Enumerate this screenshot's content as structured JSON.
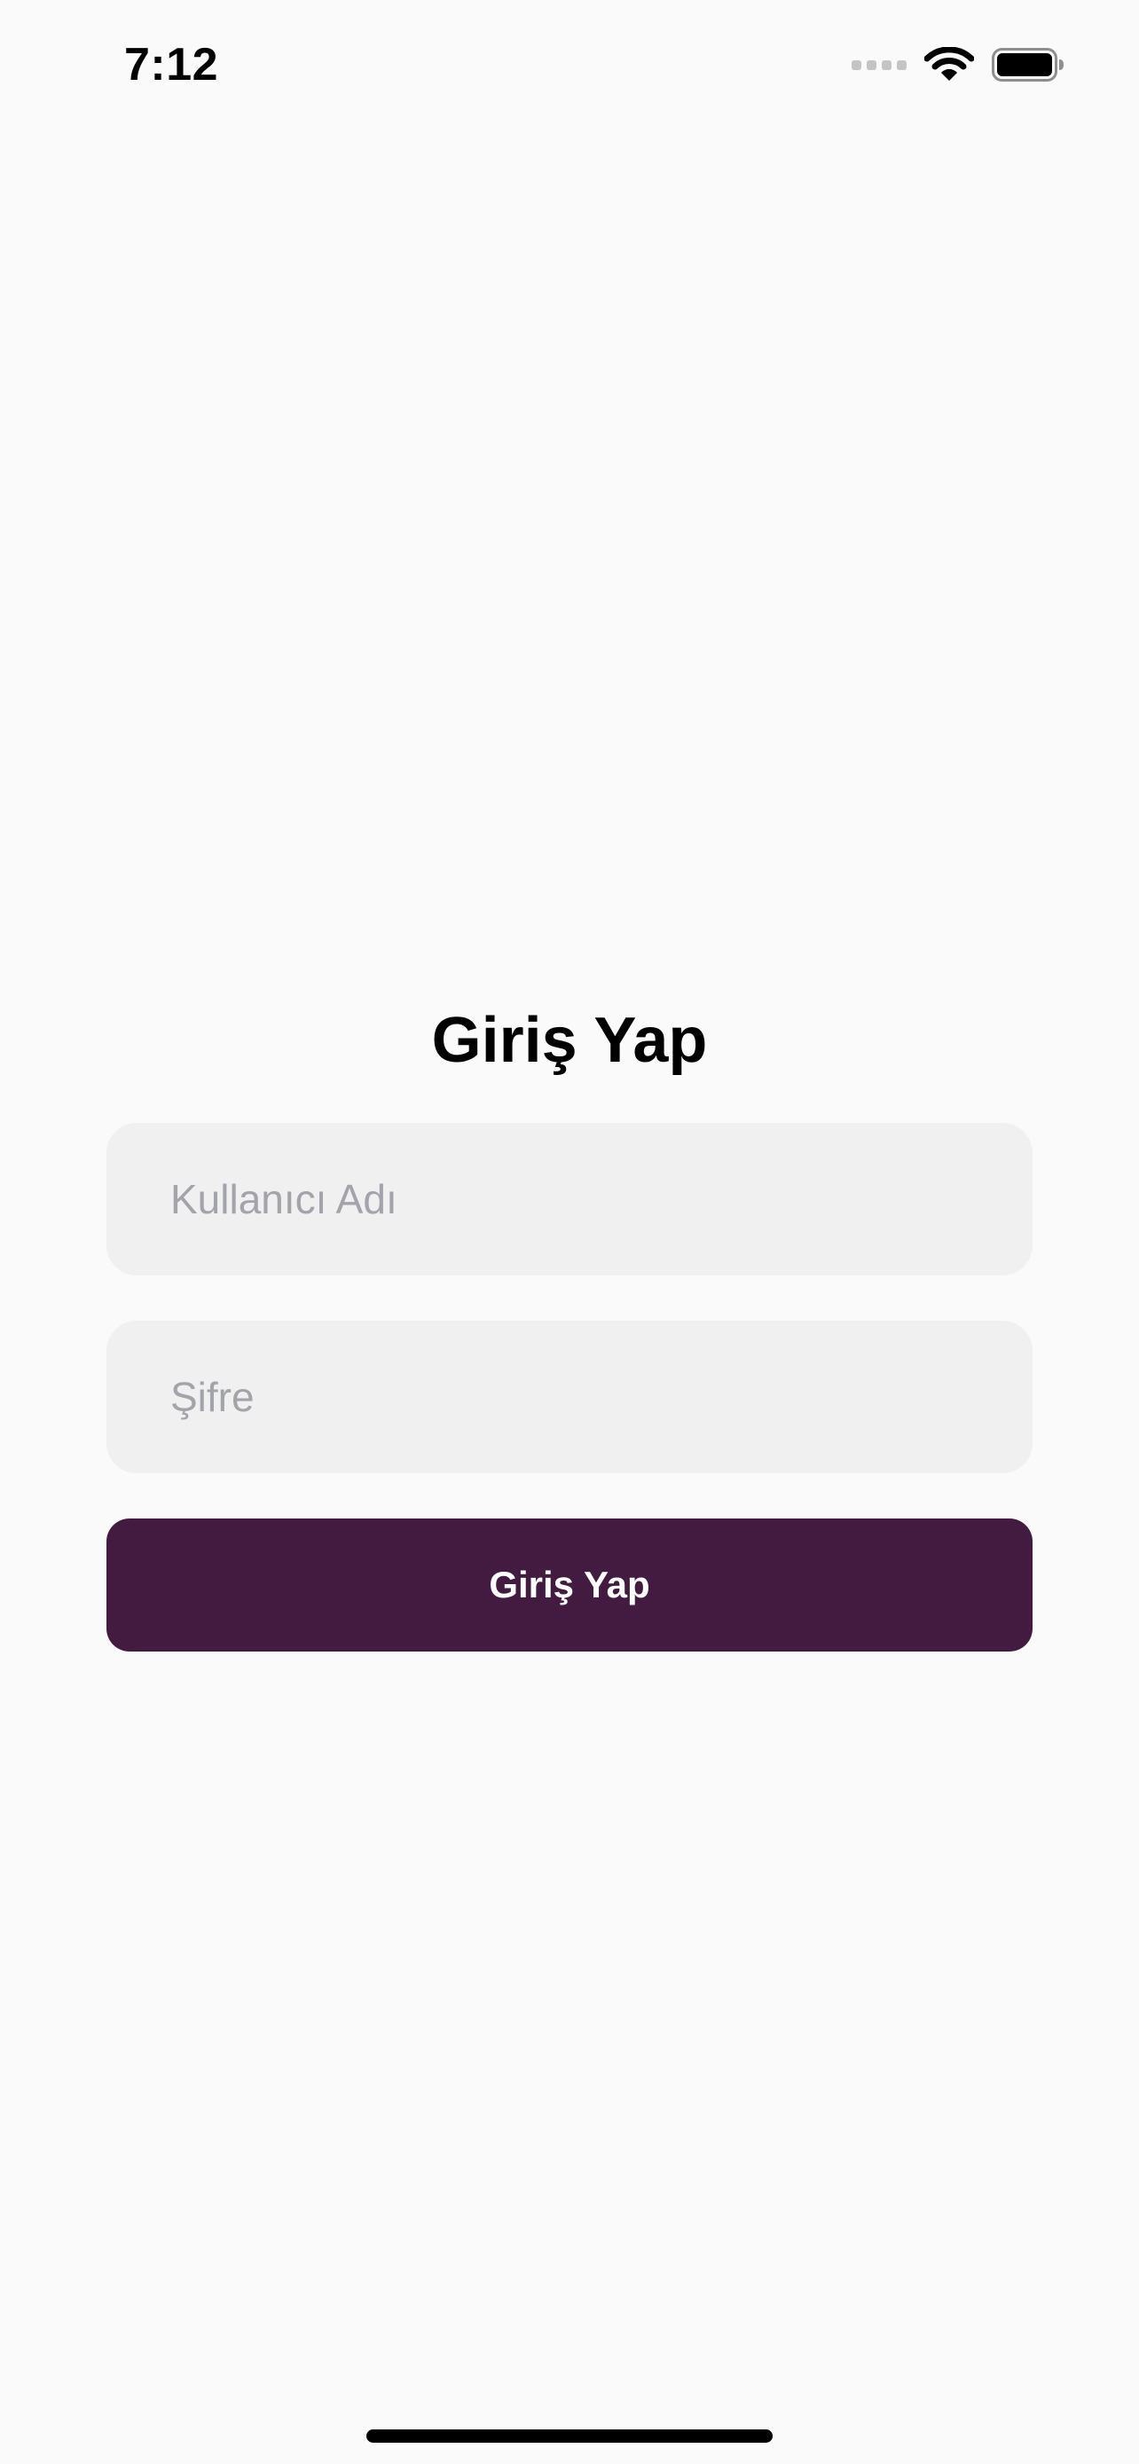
{
  "status_bar": {
    "time": "7:12",
    "icons": [
      "signal-dots-icon",
      "wifi-icon",
      "battery-icon"
    ]
  },
  "login": {
    "title": "Giriş Yap",
    "username_placeholder": "Kullanıcı Adı",
    "username_value": "",
    "password_placeholder": "Şifre",
    "password_value": "",
    "submit_label": "Giriş Yap"
  },
  "colors": {
    "background": "#fafafa",
    "field_background": "#f0f0f0",
    "placeholder": "#a3a3ab",
    "accent": "#431b40"
  }
}
